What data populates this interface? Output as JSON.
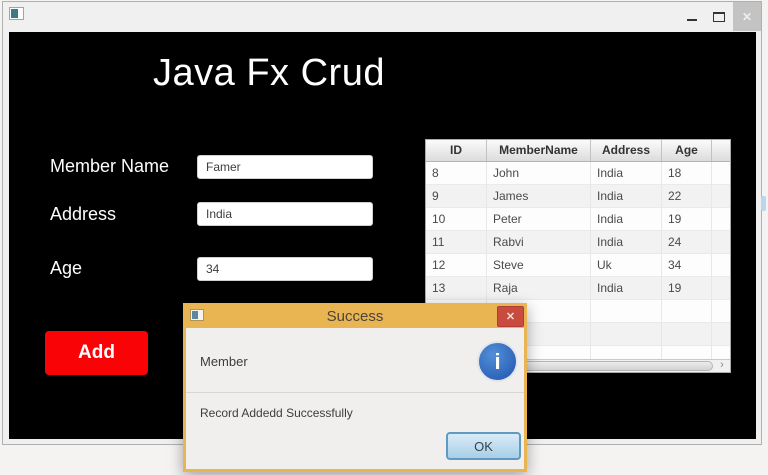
{
  "window": {
    "controls": {
      "close_glyph": "✕"
    }
  },
  "main": {
    "heading": "Java Fx Crud",
    "form": {
      "fields": [
        {
          "label": "Member Name",
          "value": "Famer"
        },
        {
          "label": "Address",
          "value": "India"
        },
        {
          "label": "Age",
          "value": "34"
        }
      ],
      "add_button_label": "Add"
    },
    "table": {
      "columns": [
        "ID",
        "MemberName",
        "Address",
        "Age"
      ],
      "rows": [
        [
          "8",
          "John",
          "India",
          "18"
        ],
        [
          "9",
          "James",
          "India",
          "22"
        ],
        [
          "10",
          "Peter",
          "India",
          "19"
        ],
        [
          "11",
          "Rabvi",
          "India",
          "24"
        ],
        [
          "12",
          "Steve",
          "Uk",
          "34"
        ],
        [
          "13",
          "Raja",
          "India",
          "19"
        ]
      ],
      "scroll_right_glyph": "›"
    }
  },
  "dialog": {
    "title": "Success",
    "header_text": "Member",
    "message": "Record Addedd Successfully",
    "ok_label": "OK",
    "close_glyph": "✕",
    "info_glyph": "i"
  },
  "colors": {
    "add_button_red": "#fa0307",
    "dialog_orange": "#e9b452",
    "dialog_close_red": "#c94a3f",
    "info_blue": "#2c62b8",
    "ok_button_blue": "#a8cee6"
  }
}
